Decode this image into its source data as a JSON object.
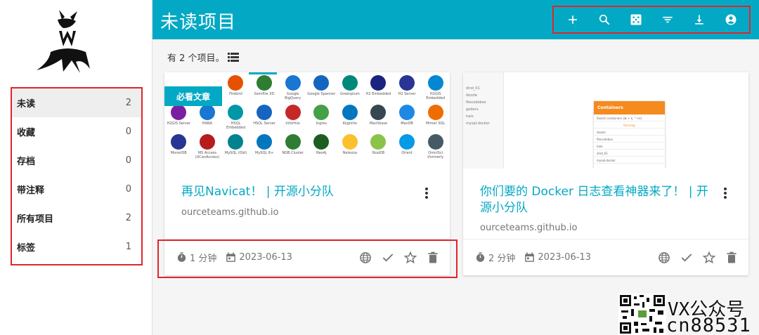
{
  "header": {
    "title": "未读项目"
  },
  "toolbar": {
    "icons": [
      "plus-icon",
      "search-icon",
      "dice-icon",
      "filter-icon",
      "download-icon",
      "account-icon"
    ]
  },
  "sidebar": {
    "items": [
      {
        "label": "未读",
        "count": "2"
      },
      {
        "label": "收藏",
        "count": "0"
      },
      {
        "label": "存档",
        "count": "0"
      },
      {
        "label": "带注释",
        "count": "0"
      },
      {
        "label": "所有项目",
        "count": "2"
      },
      {
        "label": "标签",
        "count": "1"
      }
    ]
  },
  "main": {
    "count_text": "有 2 个项目。"
  },
  "cards": [
    {
      "ribbon": "必看文章",
      "title": "再见Navicat！ | 开源小分队",
      "domain": "ourceteams.github.io",
      "reading_time": "1 分钟",
      "date": "2023-06-13",
      "databases": [
        "Firebird",
        "Gemfire XD",
        "Google BigQuery",
        "Google Spanner",
        "Greenplum",
        "H2 Embedded",
        "H2 Server",
        "H2GIS Embedded",
        "H2GIS Server",
        "HANA",
        "HSQL Embedded",
        "HSQL Server",
        "Informix",
        "Ingres",
        "Kognitio",
        "Machbase",
        "MaxDB",
        "Mimer SQL",
        "MonetDB",
        "MS Access (UCanAccess)",
        "MySQL (Old)",
        "MySQL 8+",
        "NDB Cluster",
        "Neo4j",
        "Netezza",
        "NuoDB",
        "Orient",
        "OmniSci (formerly"
      ]
    },
    {
      "title": "你们要的 Docker 日志查看神器来了！ | 开源小分队",
      "domain": "ourceteams.github.io",
      "reading_time": "2 分钟",
      "date": "2023-06-13",
      "thumb": {
        "sidebar_items": [
          "dind_01",
          "dozzle",
          "filecodebox",
          "gedaru",
          "halo",
          "mysql-docker"
        ],
        "panel_title": "Containers",
        "search_hint": "Search containers (⌘ + k, ^+k)",
        "rows": [
          "Running",
          "dozzle",
          "filecodebox",
          "halo",
          "dind_01",
          "mysql-docker"
        ]
      }
    }
  ],
  "watermark": {
    "line1": "VX公众号",
    "line2": "cn88531"
  },
  "colors": {
    "accent": "#03a9c4",
    "highlight": "#e0252b"
  }
}
